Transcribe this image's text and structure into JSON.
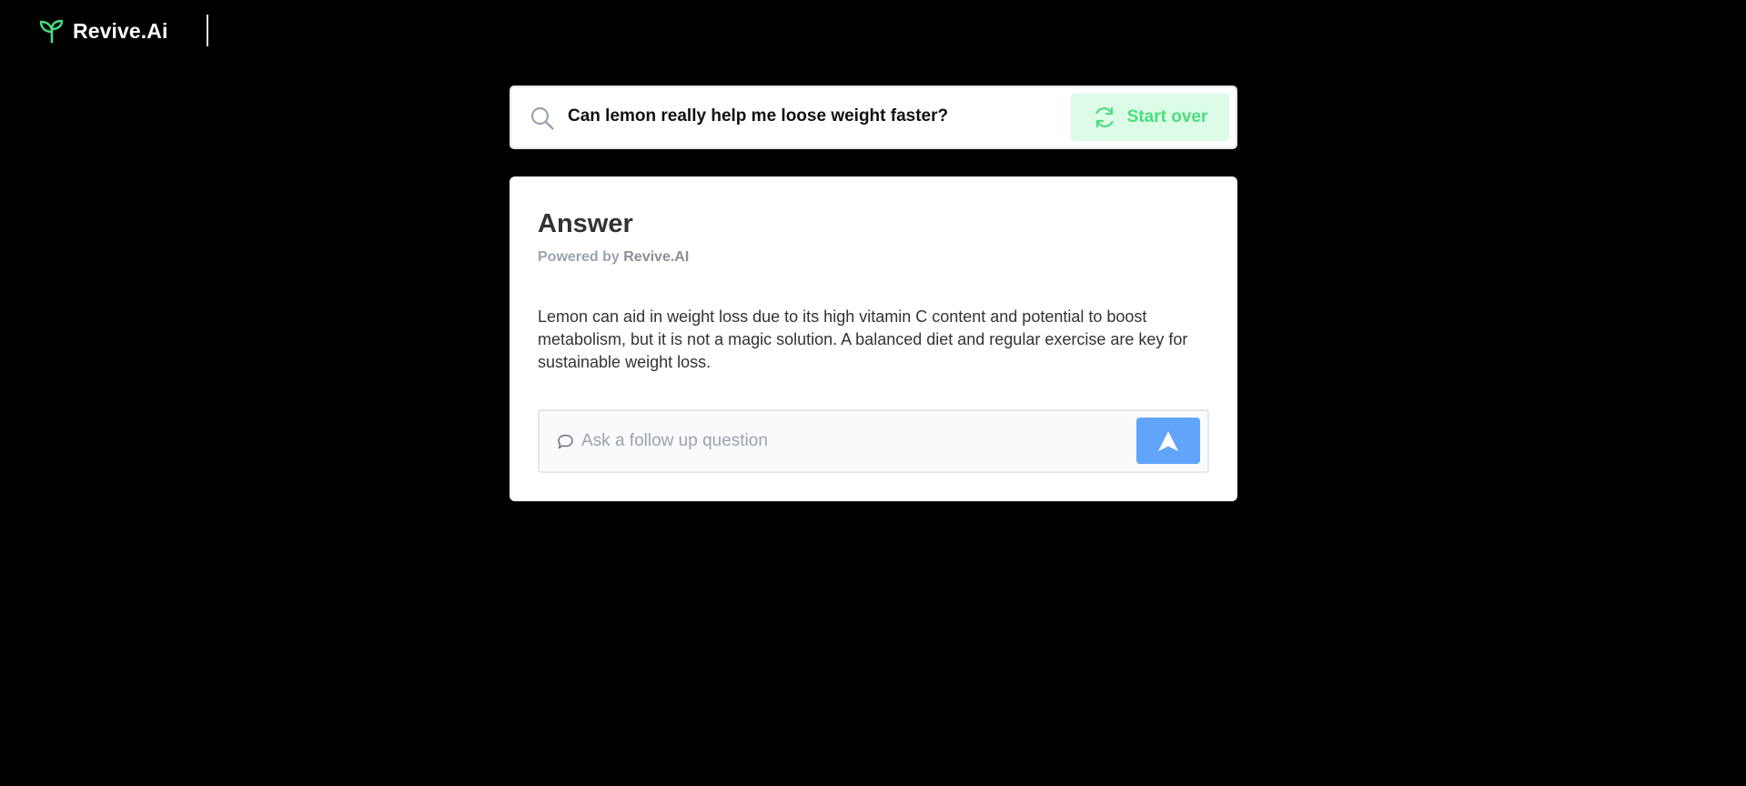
{
  "header": {
    "logo_icon": "sprout-icon",
    "brand": "Revive.Ai"
  },
  "search": {
    "icon": "search-icon",
    "query": "Can lemon really help me loose weight faster?",
    "start_over_icon": "refresh-icon",
    "start_over_label": "Start over"
  },
  "answer": {
    "title": "Answer",
    "powered_prefix": "Powered by ",
    "powered_brand": "Revive.AI",
    "text": "Lemon can aid in weight loss due to its high vitamin C content and potential to boost metabolism, but it is not a magic solution. A balanced diet and regular exercise are key for sustainable weight loss."
  },
  "followup": {
    "icon": "chat-bubble-icon",
    "placeholder": "Ask a follow up question",
    "value": "",
    "send_icon": "send-arrow-icon"
  },
  "colors": {
    "background": "#000000",
    "brand_green": "#4ade80",
    "start_over_bg": "#dcfce7",
    "send_button": "#60a5fa"
  }
}
